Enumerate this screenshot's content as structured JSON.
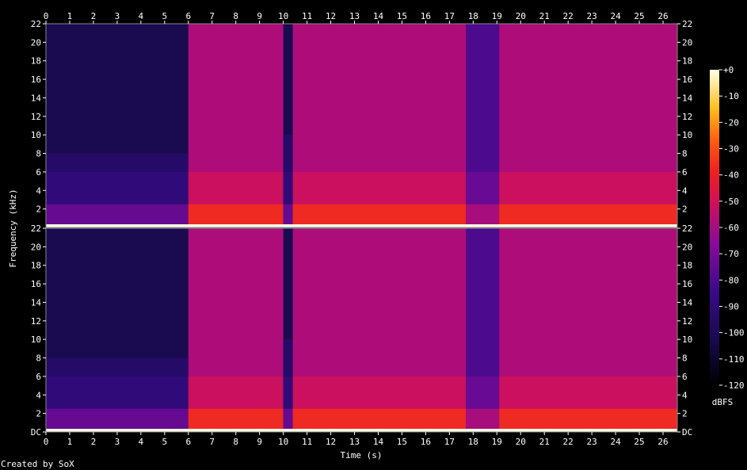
{
  "chart_data": {
    "type": "heatmap",
    "title": "",
    "xlabel": "Time (s)",
    "ylabel": "Frequency (kHz)",
    "xlim": [
      0,
      26.6
    ],
    "ylim": [
      0,
      22
    ],
    "x_ticks": [
      "0",
      "1",
      "2",
      "3",
      "4",
      "5",
      "6",
      "7",
      "8",
      "9",
      "10",
      "11",
      "12",
      "13",
      "14",
      "15",
      "16",
      "17",
      "18",
      "19",
      "20",
      "21",
      "22",
      "23",
      "24",
      "25",
      "26"
    ],
    "y_ticks_top": [
      "2",
      "4",
      "6",
      "8",
      "10",
      "12",
      "14",
      "16",
      "18",
      "20",
      "22"
    ],
    "y_ticks_bottom": [
      "DC",
      "2",
      "4",
      "6",
      "8",
      "10",
      "12",
      "14",
      "16",
      "18",
      "20",
      "22"
    ],
    "channels": 2,
    "colorbar": {
      "label": "dBFS",
      "ticks": [
        "+0",
        "-10",
        "-20",
        "-30",
        "-40",
        "-50",
        "-60",
        "-70",
        "-80",
        "-90",
        "-100",
        "-110",
        "-120"
      ],
      "range": [
        -120,
        0
      ]
    },
    "segments": [
      {
        "start": 0,
        "end": 6.0,
        "level_db": -95,
        "cutoff_khz": 8
      },
      {
        "start": 6.0,
        "end": 10.0,
        "level_db": -58,
        "cutoff_khz": 22
      },
      {
        "start": 10.0,
        "end": 10.4,
        "level_db": -95,
        "cutoff_khz": 10
      },
      {
        "start": 10.4,
        "end": 17.7,
        "level_db": -58,
        "cutoff_khz": 22
      },
      {
        "start": 17.7,
        "end": 19.1,
        "level_db": -80,
        "cutoff_khz": 22
      },
      {
        "start": 19.1,
        "end": 26.6,
        "level_db": -58,
        "cutoff_khz": 22
      }
    ]
  },
  "footer": "Created by SoX"
}
